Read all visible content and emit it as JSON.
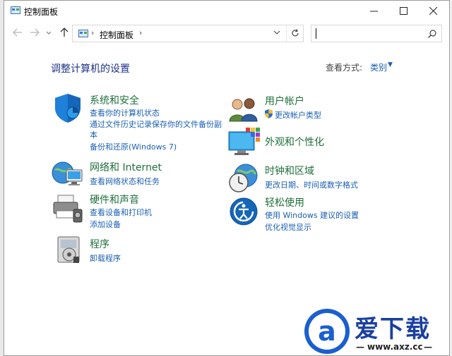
{
  "window": {
    "title": "控制面板"
  },
  "address": {
    "path": "控制面板",
    "search_placeholder": ""
  },
  "main": {
    "heading": "调整计算机的设置",
    "view_by_label": "查看方式:",
    "view_by_value": "类别"
  },
  "categories": [
    {
      "id": "security",
      "title": "系统和安全",
      "links": [
        "查看你的计算机状态",
        "通过文件历史记录保存你的文件备份副",
        "本",
        "备份和还原(Windows 7)"
      ]
    },
    {
      "id": "network",
      "title": "网络和 Internet",
      "links": [
        "查看网络状态和任务"
      ]
    },
    {
      "id": "hardware",
      "title": "硬件和声音",
      "links": [
        "查看设备和打印机",
        "添加设备"
      ]
    },
    {
      "id": "programs",
      "title": "程序",
      "links": [
        "卸载程序"
      ]
    },
    {
      "id": "users",
      "title": "用户帐户",
      "links": [
        "更改帐户类型"
      ]
    },
    {
      "id": "appearance",
      "title": "外观和个性化",
      "links": []
    },
    {
      "id": "clock",
      "title": "时钟和区域",
      "links": [
        "更改日期、时间或数字格式"
      ]
    },
    {
      "id": "ease",
      "title": "轻松使用",
      "links": [
        "使用 Windows 建议的设置",
        "优化视觉显示"
      ]
    }
  ],
  "watermark": {
    "brand": "爱下载",
    "url": "www.axz.cc",
    "logo_letter": "a"
  },
  "colors": {
    "link": "#1a5fb4",
    "category_title": "#1e6f3b",
    "heading": "#1e3287",
    "watermark": "#1a5fd0"
  }
}
